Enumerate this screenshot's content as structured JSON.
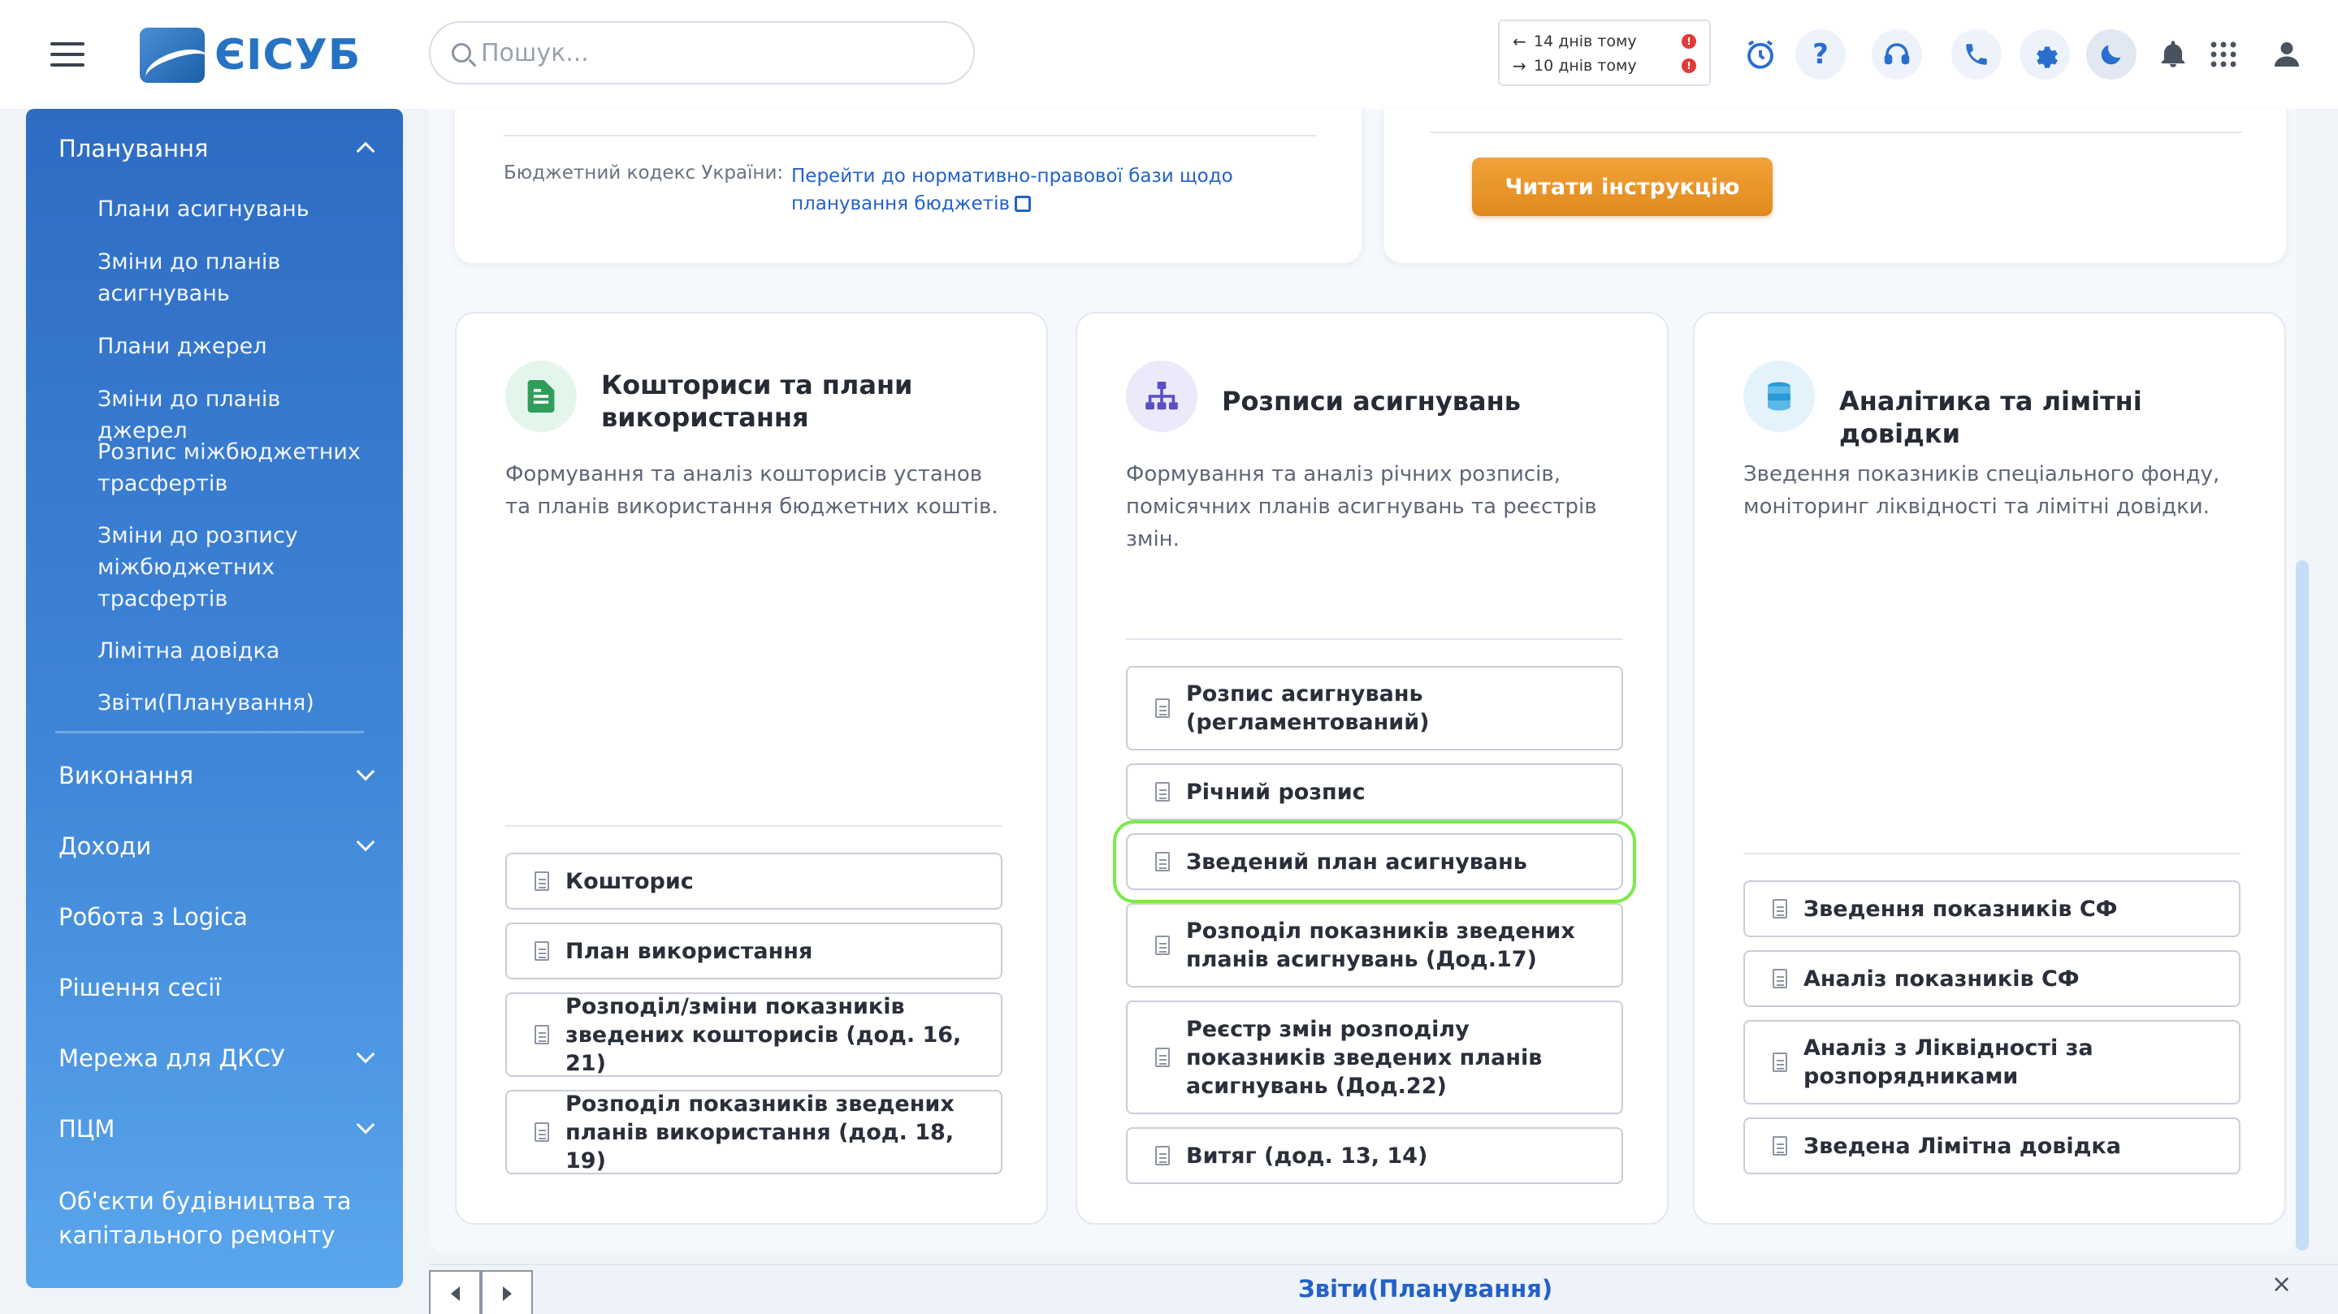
{
  "app": {
    "logo_text": "ЄІСУБ"
  },
  "search": {
    "placeholder": "Пошук..."
  },
  "dates": [
    {
      "arrow": "←",
      "text": "14 днів тому",
      "badge": "!"
    },
    {
      "arrow": "→",
      "text": "10 днів тому",
      "badge": "!"
    }
  ],
  "toolbar_icons": [
    "alarm-clock-icon",
    "help-icon",
    "support-headset-icon",
    "phone-icon",
    "settings-gear-icon",
    "dark-mode-moon-icon",
    "notifications-bell-icon",
    "apps-grid-icon",
    "user-avatar-icon"
  ],
  "sidebar": {
    "planning": {
      "label": "Планування",
      "items": [
        "Плани асигнувань",
        "Зміни до планів асигнувань",
        "Плани джерел",
        "Зміни до планів джерел",
        "Розпис міжбюджетних трасфертів",
        "Зміни до розпису міжбюджетних трасфертів",
        "Лімітна довідка",
        "Звіти(Планування)"
      ]
    },
    "groups": [
      "Виконання",
      "Доходи",
      "Робота з Logica",
      "Рішення сесії",
      "Мережа для ДКСУ",
      "ПЦМ",
      "Об'єкти будівництва та капітального ремонту"
    ]
  },
  "top_panel": {
    "budget_code_label": "Бюджетний кодекс України:",
    "budget_code_link": "Перейти до нормативно-правової бази щодо планування бюджетів",
    "instruction_button": "Читати інструкцію"
  },
  "cards": [
    {
      "title": "Кошториси та плани використання",
      "description": "Формування та аналіз кошторисів установ та планів використання бюджетних коштів.",
      "buttons": [
        "Кошторис",
        "План використання",
        "Розподіл/зміни показників зведених кошторисів (дод. 16, 21)",
        "Розподіл показників зведених планів використання (дод. 18, 19)"
      ]
    },
    {
      "title": "Розписи асигнувань",
      "description": "Формування та аналіз річних розписів, помісячних планів асигнувань та реєстрів змін.",
      "buttons": [
        "Розпис асигнувань (регламентований)",
        "Річний розпис",
        "Зведений план асигнувань",
        "Розподіл показників зведених планів асигнувань (Дод.17)",
        "Реєстр змін розподілу показників зведених планів асигнувань (Дод.22)",
        "Витяг (дод. 13, 14)"
      ]
    },
    {
      "title": "Аналітика та лімітні довідки",
      "description": "Зведення показників спеціального фонду, моніторинг ліквідності та лімітні довідки.",
      "buttons": [
        "Зведення показників СФ",
        "Аналіз показників СФ",
        "Аналіз з Ліквідності за розпорядниками",
        "Зведена Лімітна довідка"
      ]
    }
  ],
  "bottom_bar": {
    "active_tab": "Звіти(Планування)",
    "close": "×"
  },
  "colors": {
    "accent": "#2461c7",
    "sidebar": "#3f86d8",
    "instruction_button": "#e8921f",
    "highlight": "#7bea4a"
  }
}
